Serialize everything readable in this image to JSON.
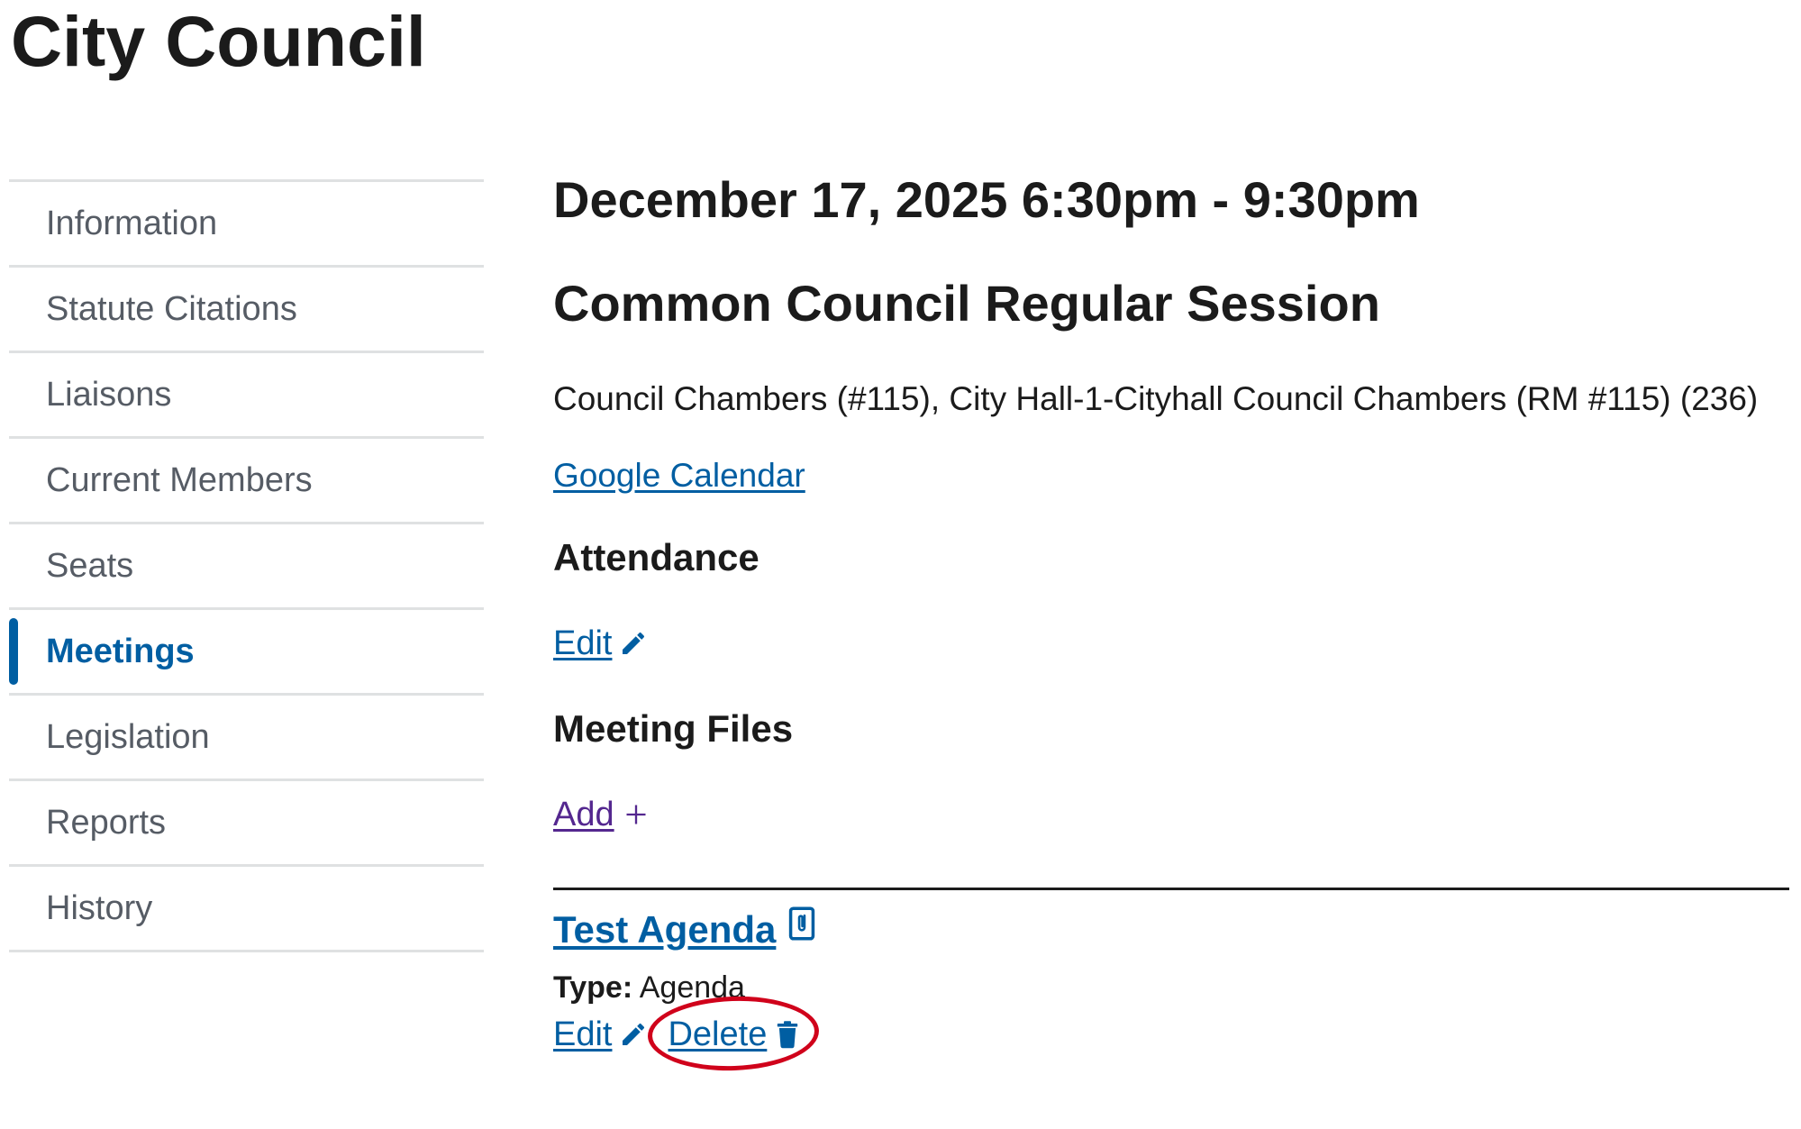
{
  "page": {
    "title": "City Council"
  },
  "sidenav": {
    "items": [
      {
        "label": "Information",
        "current": false
      },
      {
        "label": "Statute Citations",
        "current": false
      },
      {
        "label": "Liaisons",
        "current": false
      },
      {
        "label": "Current Members",
        "current": false
      },
      {
        "label": "Seats",
        "current": false
      },
      {
        "label": "Meetings",
        "current": true
      },
      {
        "label": "Legislation",
        "current": false
      },
      {
        "label": "Reports",
        "current": false
      },
      {
        "label": "History",
        "current": false
      }
    ]
  },
  "meeting": {
    "date": "December 17, 2025 6:30pm - 9:30pm",
    "title": "Common Council Regular Session",
    "location": "Council Chambers (#115), City Hall-1-Cityhall Council Chambers (RM #115) (236)",
    "calendar_link": "Google Calendar"
  },
  "attendance": {
    "heading": "Attendance",
    "edit_label": "Edit",
    "edit_icon": "pencil-icon"
  },
  "meeting_files": {
    "heading": "Meeting Files",
    "add_label": "Add",
    "add_icon": "plus-icon",
    "files": [
      {
        "title": "Test Agenda",
        "title_icon": "attachment-icon",
        "type_label": "Type:",
        "type_value": "Agenda",
        "edit_label": "Edit",
        "edit_icon": "pencil-icon",
        "delete_label": "Delete",
        "delete_icon": "trash-icon",
        "delete_highlighted": true
      }
    ]
  },
  "colors": {
    "link": "#005ea2",
    "visited_link": "#54278f",
    "current_nav": "#005ea2",
    "nav_text": "#565c65",
    "highlight_ring": "#d0021b"
  }
}
